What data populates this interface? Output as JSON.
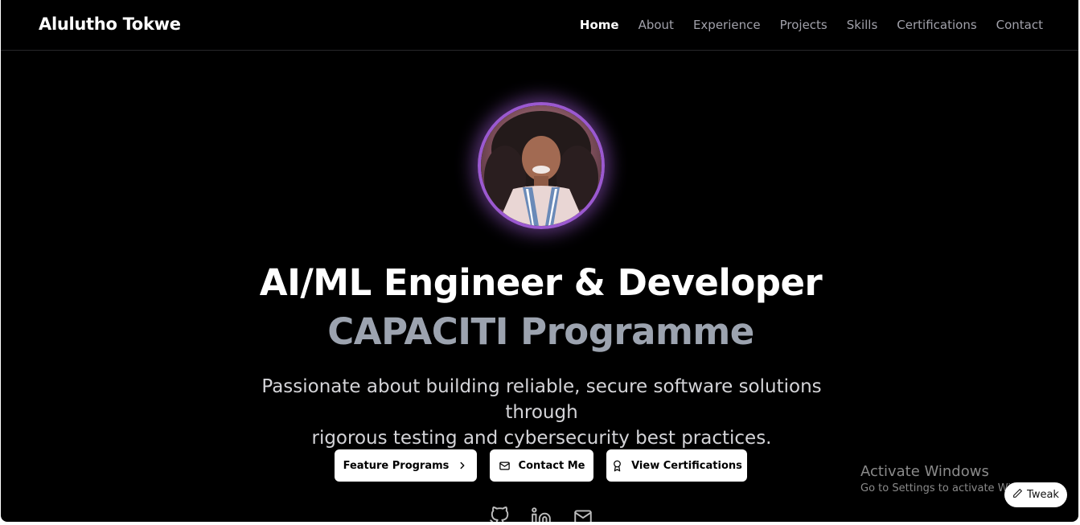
{
  "nav": {
    "brand": "Alulutho Tokwe",
    "links": [
      {
        "label": "Home",
        "active": true
      },
      {
        "label": "About",
        "active": false
      },
      {
        "label": "Experience",
        "active": false
      },
      {
        "label": "Projects",
        "active": false
      },
      {
        "label": "Skills",
        "active": false
      },
      {
        "label": "Certifications",
        "active": false
      },
      {
        "label": "Contact",
        "active": false
      }
    ]
  },
  "hero": {
    "avatar_icon": "profile-photo",
    "accent_color": "#9b59d0",
    "title": "AI/ML Engineer & Developer",
    "subtitle": "CAPACITI Programme",
    "description_line1": "Passionate about building reliable, secure software solutions through",
    "description_line2": "rigorous testing and cybersecurity best practices.",
    "buttons": [
      {
        "label": "Feature Programs",
        "icon": "chevron-right-icon"
      },
      {
        "label": "Contact Me",
        "icon": "mail-icon"
      },
      {
        "label": "View Certifications",
        "icon": "award-icon"
      }
    ],
    "socials": [
      {
        "icon": "github-icon"
      },
      {
        "icon": "linkedin-icon"
      },
      {
        "icon": "mail-icon"
      }
    ]
  },
  "overlay": {
    "activate_title": "Activate Windows",
    "activate_sub": "Go to Settings to activate Windows.",
    "tweak_label": "Tweak",
    "tweak_icon": "pencil-icon"
  }
}
